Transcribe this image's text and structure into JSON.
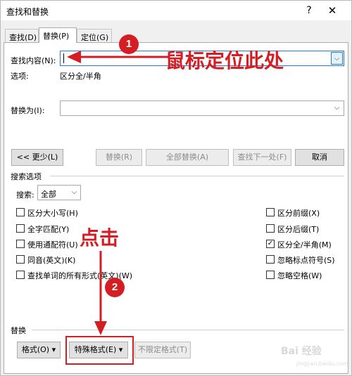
{
  "window": {
    "title": "查找和替换",
    "help": "?",
    "close": "✕"
  },
  "tabs": [
    {
      "label": "查找(D)",
      "active": false
    },
    {
      "label": "替换(P)",
      "active": true
    },
    {
      "label": "定位(G)",
      "active": false
    }
  ],
  "find": {
    "label": "查找内容(N):",
    "value": "",
    "options_label": "选项:",
    "options_value": "区分全/半角"
  },
  "replace": {
    "label": "替换为(I):",
    "value": ""
  },
  "buttons": {
    "less": "<< 更少(L)",
    "replace": "替换(R)",
    "replace_all": "全部替换(A)",
    "find_next": "查找下一处(F)",
    "cancel": "取消"
  },
  "search_options": {
    "heading": "搜索选项",
    "search_label": "搜索:",
    "search_value": "全部",
    "left": [
      {
        "label": "区分大小写(H)",
        "checked": false
      },
      {
        "label": "全字匹配(Y)",
        "checked": false
      },
      {
        "label": "使用通配符(U)",
        "checked": false
      },
      {
        "label": "同音(英文)(K)",
        "checked": false
      },
      {
        "label": "查找单词的所有形式(英文)(W)",
        "checked": false
      }
    ],
    "right": [
      {
        "label": "区分前缀(X)",
        "checked": false
      },
      {
        "label": "区分后缀(T)",
        "checked": false
      },
      {
        "label": "区分全/半角(M)",
        "checked": true
      },
      {
        "label": "忽略标点符号(S)",
        "checked": false
      },
      {
        "label": "忽略空格(W)",
        "checked": false
      }
    ]
  },
  "replace_section": {
    "heading": "替换",
    "format": "格式(O) ▾",
    "special": "特殊格式(E) ▾",
    "no_format": "不限定格式(T)"
  },
  "annotations": {
    "badge1": "1",
    "badge2": "2",
    "text1": "鼠标定位此处",
    "text2": "点击",
    "color": "#d51e24"
  },
  "watermark": {
    "main": "Bai 经验",
    "sub": "jingyan.baidu.com"
  }
}
